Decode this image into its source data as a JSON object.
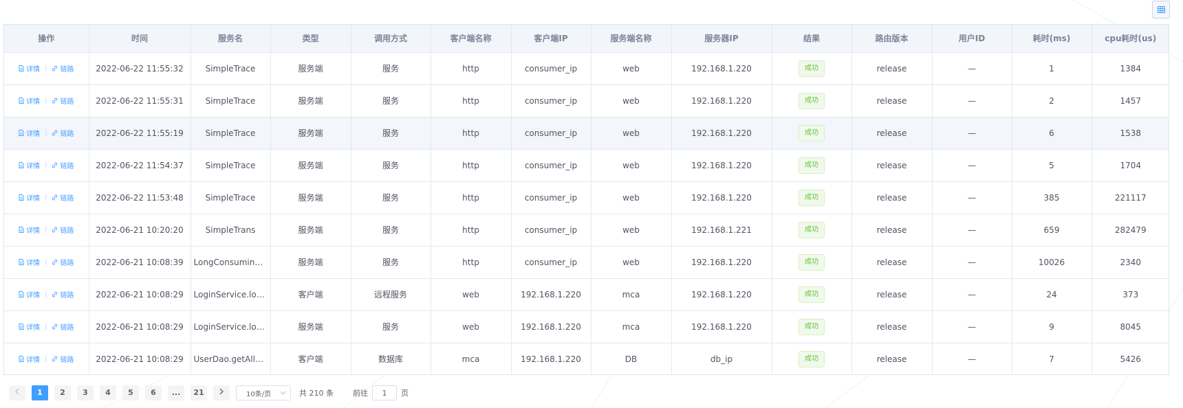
{
  "toolbar": {
    "column_toggle_icon": "table-icon"
  },
  "table": {
    "headers": [
      "操作",
      "时间",
      "服务名",
      "类型",
      "调用方式",
      "客户端名称",
      "客户端IP",
      "服务端名称",
      "服务器IP",
      "结果",
      "路由版本",
      "用户ID",
      "耗时(ms)",
      "cpu耗时(us)"
    ],
    "ops": {
      "detail": "详情",
      "trace": "链路"
    },
    "rows": [
      {
        "time": "2022-06-22 11:55:32",
        "service": "SimpleTrace",
        "type": "服务端",
        "call": "服务",
        "client_name": "http",
        "client_ip": "consumer_ip",
        "server_name": "web",
        "server_ip": "192.168.1.220",
        "result": "成功",
        "route": "release",
        "user_id": "—",
        "cost": "1",
        "cpu": "1384"
      },
      {
        "time": "2022-06-22 11:55:31",
        "service": "SimpleTrace",
        "type": "服务端",
        "call": "服务",
        "client_name": "http",
        "client_ip": "consumer_ip",
        "server_name": "web",
        "server_ip": "192.168.1.220",
        "result": "成功",
        "route": "release",
        "user_id": "—",
        "cost": "2",
        "cpu": "1457"
      },
      {
        "time": "2022-06-22 11:55:19",
        "service": "SimpleTrace",
        "type": "服务端",
        "call": "服务",
        "client_name": "http",
        "client_ip": "consumer_ip",
        "server_name": "web",
        "server_ip": "192.168.1.220",
        "result": "成功",
        "route": "release",
        "user_id": "—",
        "cost": "6",
        "cpu": "1538"
      },
      {
        "time": "2022-06-22 11:54:37",
        "service": "SimpleTrace",
        "type": "服务端",
        "call": "服务",
        "client_name": "http",
        "client_ip": "consumer_ip",
        "server_name": "web",
        "server_ip": "192.168.1.220",
        "result": "成功",
        "route": "release",
        "user_id": "—",
        "cost": "5",
        "cpu": "1704"
      },
      {
        "time": "2022-06-22 11:53:48",
        "service": "SimpleTrace",
        "type": "服务端",
        "call": "服务",
        "client_name": "http",
        "client_ip": "consumer_ip",
        "server_name": "web",
        "server_ip": "192.168.1.220",
        "result": "成功",
        "route": "release",
        "user_id": "—",
        "cost": "385",
        "cpu": "221117"
      },
      {
        "time": "2022-06-21 10:20:20",
        "service": "SimpleTrans",
        "type": "服务端",
        "call": "服务",
        "client_name": "http",
        "client_ip": "consumer_ip",
        "server_name": "web",
        "server_ip": "192.168.1.221",
        "result": "成功",
        "route": "release",
        "user_id": "—",
        "cost": "659",
        "cpu": "282479"
      },
      {
        "time": "2022-06-21 10:08:39",
        "service": "LongConsuming...",
        "type": "服务端",
        "call": "服务",
        "client_name": "http",
        "client_ip": "consumer_ip",
        "server_name": "web",
        "server_ip": "192.168.1.220",
        "result": "成功",
        "route": "release",
        "user_id": "—",
        "cost": "10026",
        "cpu": "2340"
      },
      {
        "time": "2022-06-21 10:08:29",
        "service": "LoginService.login",
        "type": "客户端",
        "call": "远程服务",
        "client_name": "web",
        "client_ip": "192.168.1.220",
        "server_name": "mca",
        "server_ip": "192.168.1.220",
        "result": "成功",
        "route": "release",
        "user_id": "—",
        "cost": "24",
        "cpu": "373"
      },
      {
        "time": "2022-06-21 10:08:29",
        "service": "LoginService.login",
        "type": "服务端",
        "call": "服务",
        "client_name": "web",
        "client_ip": "192.168.1.220",
        "server_name": "mca",
        "server_ip": "192.168.1.220",
        "result": "成功",
        "route": "release",
        "user_id": "—",
        "cost": "9",
        "cpu": "8045"
      },
      {
        "time": "2022-06-21 10:08:29",
        "service": "UserDao.getAllU...",
        "type": "客户端",
        "call": "数据库",
        "client_name": "mca",
        "client_ip": "192.168.1.220",
        "server_name": "DB",
        "server_ip": "db_ip",
        "result": "成功",
        "route": "release",
        "user_id": "—",
        "cost": "7",
        "cpu": "5426"
      }
    ]
  },
  "pagination": {
    "prev": "<",
    "next": ">",
    "pages": [
      "1",
      "2",
      "3",
      "4",
      "5",
      "6",
      "...",
      "21"
    ],
    "current": "1",
    "page_size": "10条/页",
    "total": "共 210 条",
    "goto_prefix": "前往",
    "goto_value": "1",
    "goto_suffix": "页"
  },
  "colors": {
    "accent": "#409eff",
    "success": "#67c23a"
  }
}
